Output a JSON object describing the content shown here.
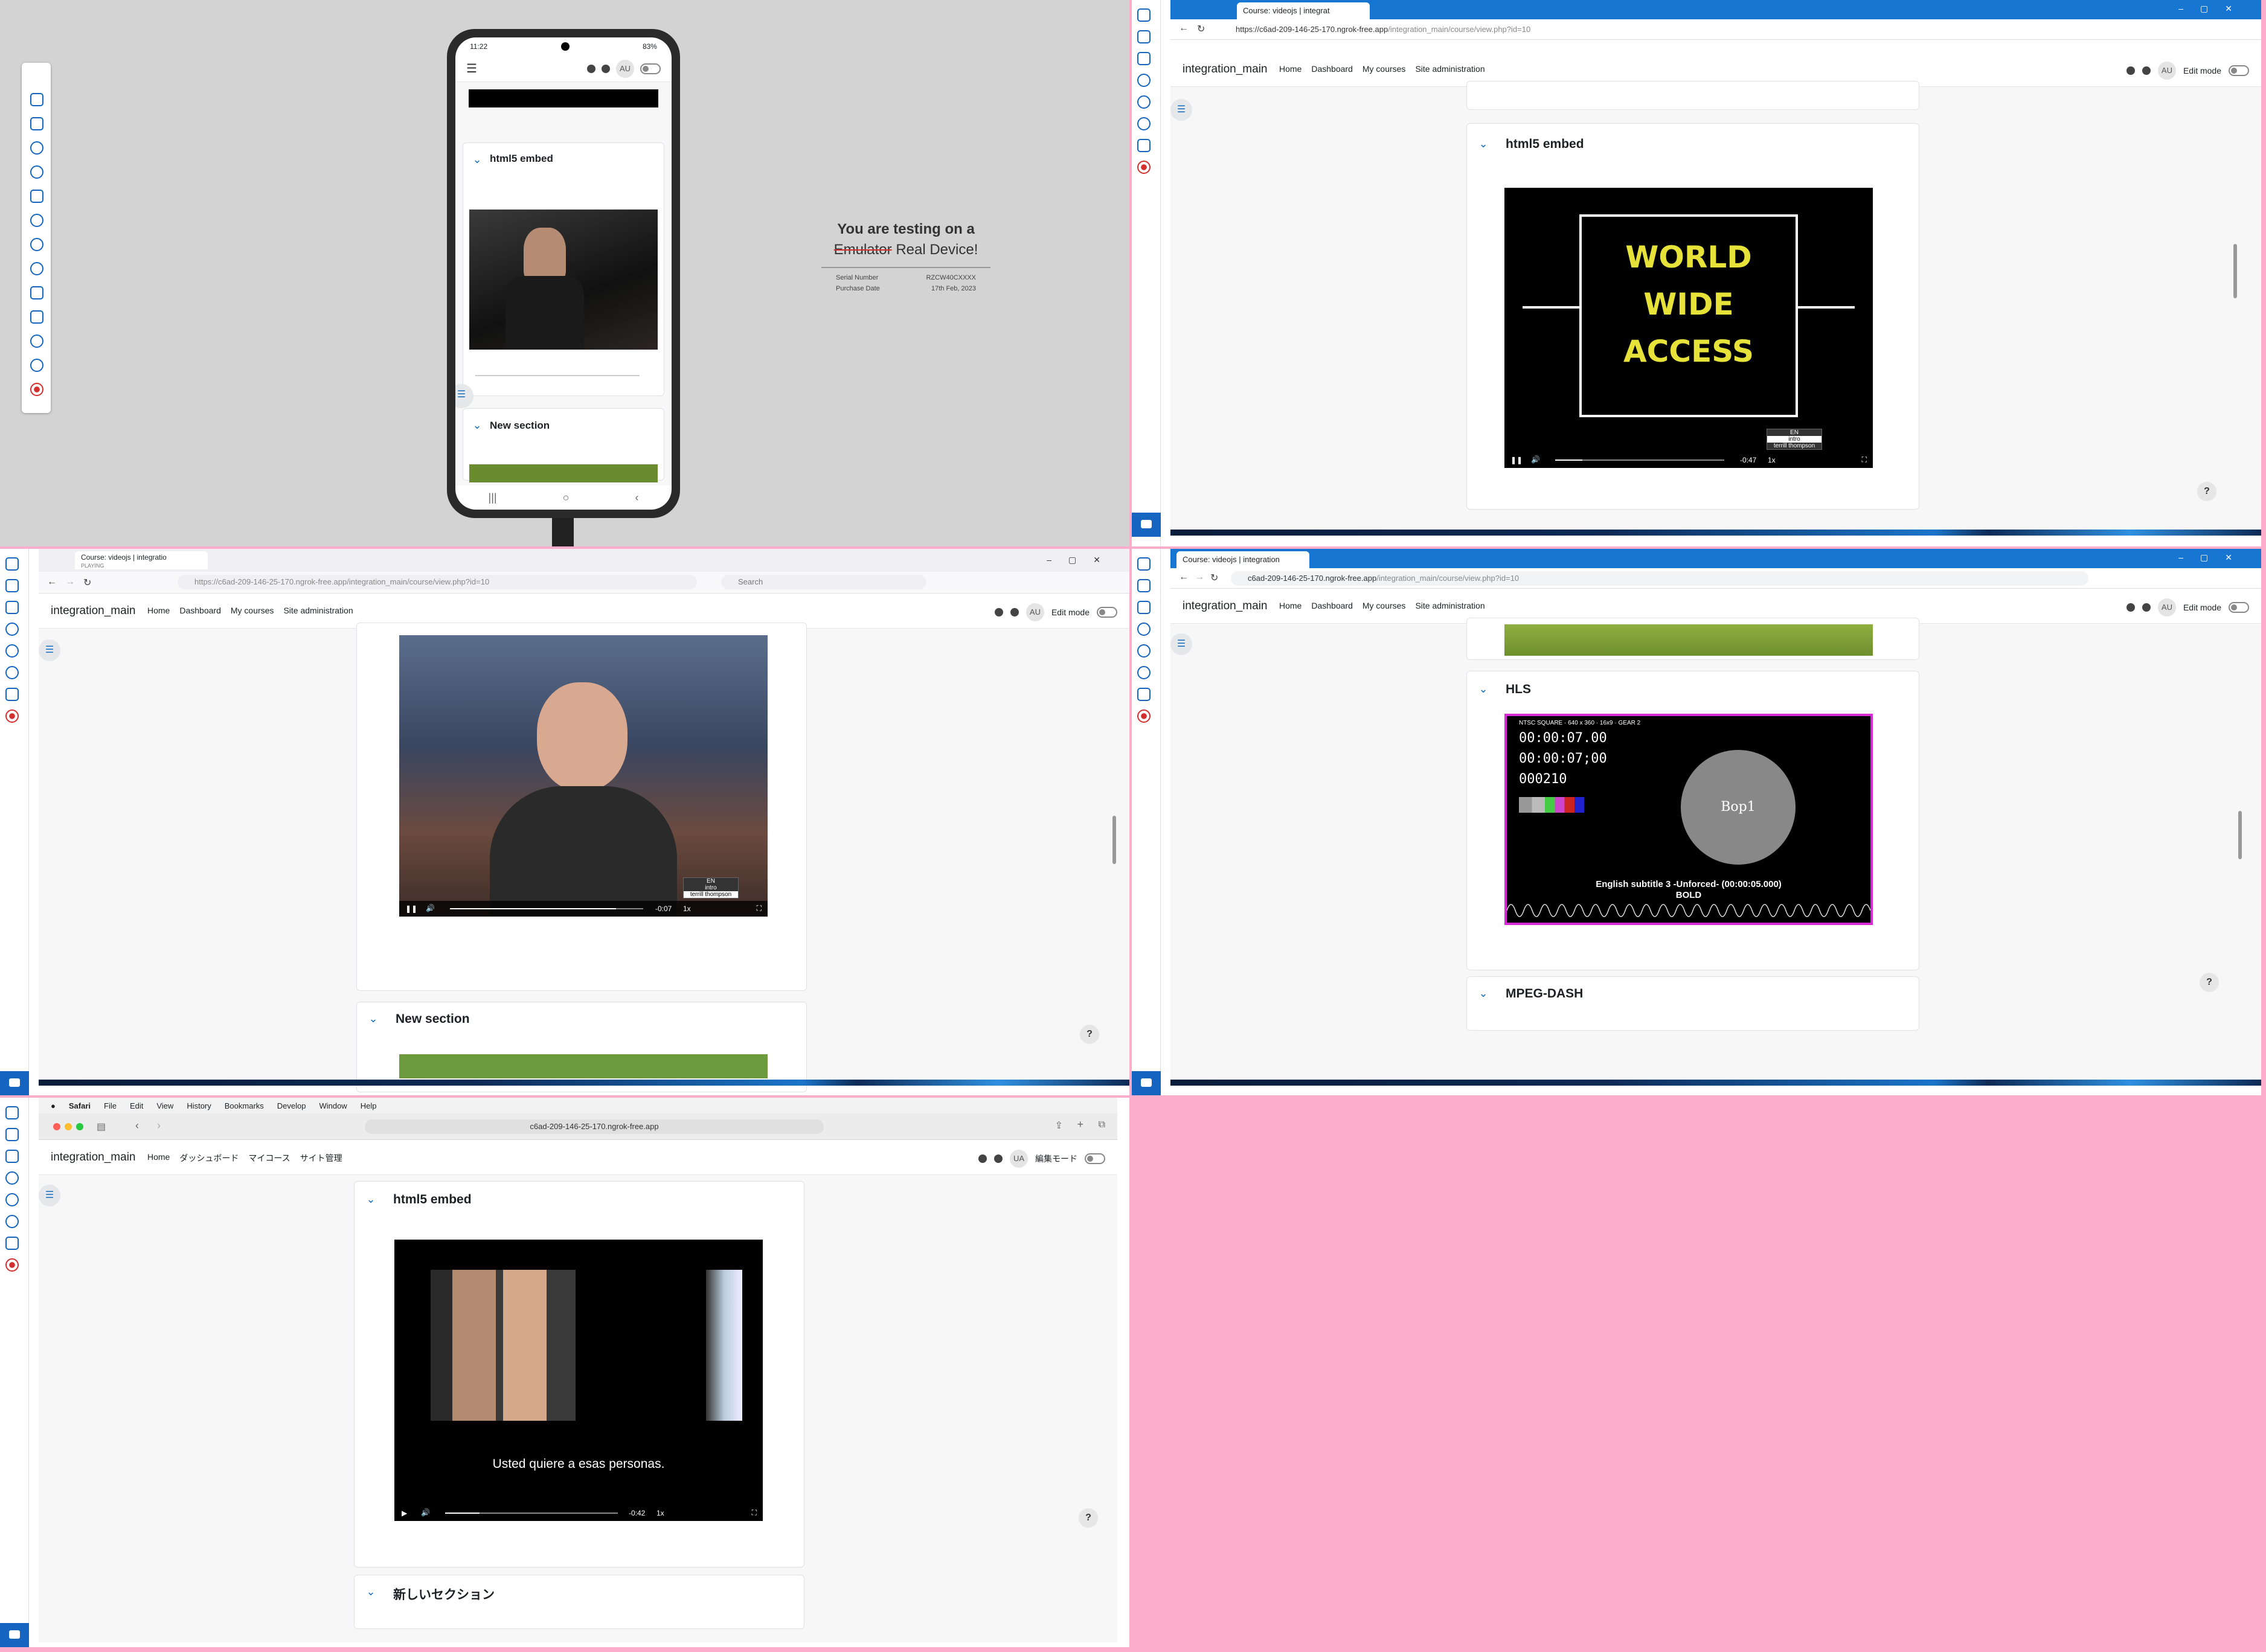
{
  "device": {
    "time": "11:22",
    "battery": "83%",
    "section1": "html5 embed",
    "section2": "New section",
    "avatar": "AU"
  },
  "banner": {
    "line1": "You are testing on a",
    "struck": "Emulator",
    "line2rest": " Real Device!",
    "serial_label": "Serial Number",
    "serial_value": "RZCW40CXXXX",
    "purchase_label": "Purchase Date",
    "purchase_value": "17th Feb, 2023"
  },
  "edge": {
    "tab": "Course: videojs | integrat",
    "url_base": "https://c6ad-209-146-25-170.ngrok-free.app",
    "url_path": "/integration_main/course/view.php?id=10",
    "section": "html5 embed",
    "video_lines": [
      "WORLD",
      "WIDE",
      "ACCESS"
    ],
    "time": "-0:47",
    "rate": "1x",
    "menu": [
      "EN",
      "intro",
      "terrill thompson"
    ]
  },
  "nav": {
    "site": "integration_main",
    "links": [
      "Home",
      "Dashboard",
      "My courses",
      "Site administration"
    ],
    "avatar": "AU",
    "edit": "Edit mode"
  },
  "firefox": {
    "tab": "Course: videojs | integratio",
    "tab_sub": "PLAYING",
    "url_base": "https://c6ad-209-146-25-170.ngrok-free.app",
    "url_path": "/integration_main/course/view.php?id=10",
    "search": "Search",
    "time": "-0:07",
    "rate": "1x",
    "menu": [
      "EN",
      "intro",
      "terrill thompson"
    ],
    "section": "New section"
  },
  "chrome": {
    "tab": "Course: videojs | integration",
    "url_base": "c6ad-209-146-25-170.ngrok-free.app",
    "url_path": "/integration_main/course/view.php?id=10",
    "section": "HLS",
    "section2": "MPEG-DASH",
    "hls_header": "NTSC SQUARE · 640 x 360 · 16x9 · GEAR 2",
    "tc1": "00:00:07.00",
    "tc2": "00:00:07;00",
    "frame": "000210",
    "circle": "Bop1",
    "subtitle1": "English subtitle 3 -Unforced- (00:00:05.000)",
    "subtitle2": "BOLD"
  },
  "safari": {
    "menu": [
      "Safari",
      "File",
      "Edit",
      "View",
      "History",
      "Bookmarks",
      "Develop",
      "Window",
      "Help"
    ],
    "url": "c6ad-209-146-25-170.ngrok-free.app",
    "site": "integration_main",
    "links": [
      "Home",
      "ダッシュボード",
      "マイコース",
      "サイト管理"
    ],
    "avatar": "UA",
    "edit": "編集モード",
    "section": "html5 embed",
    "subtitle": "Usted quiere a esas personas.",
    "time": "-0:42",
    "rate": "1x",
    "section2": "新しいセクション"
  },
  "help": "?",
  "colors": {
    "pink": "#fbadc9",
    "blue": "#1676d2",
    "moodle": "#0f6cbf"
  }
}
